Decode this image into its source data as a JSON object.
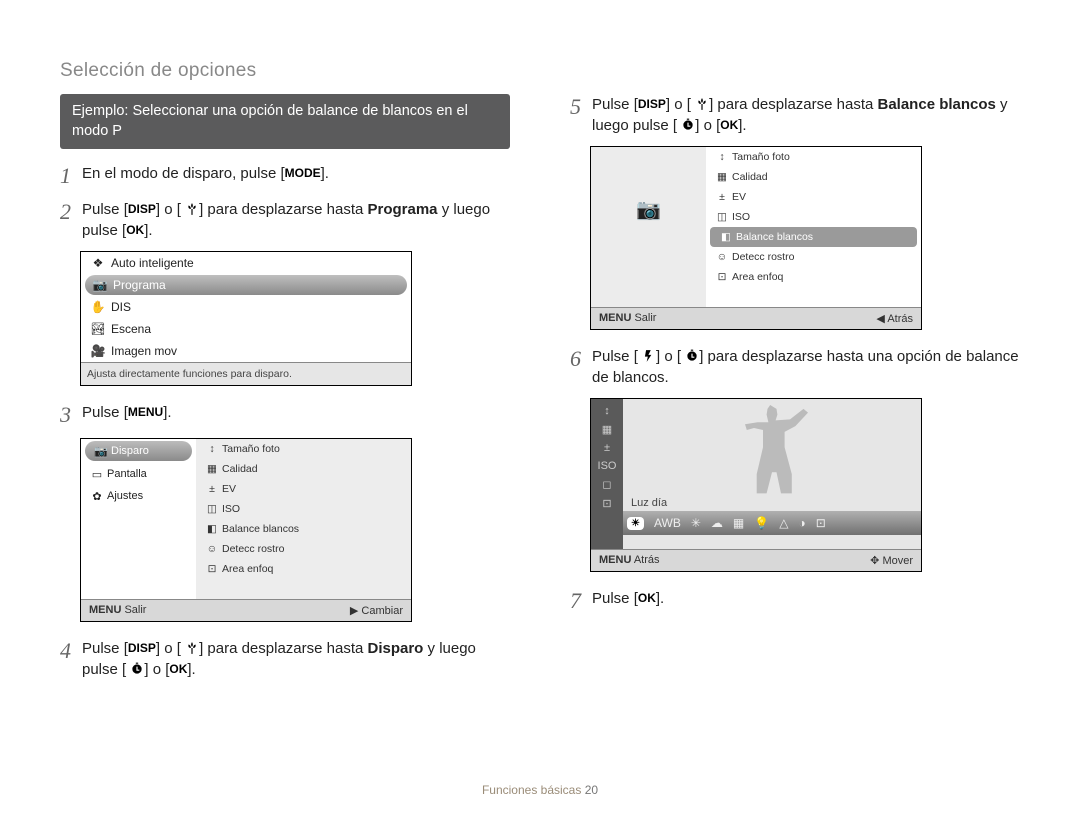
{
  "header": "Selección de opciones",
  "example_pill": "Ejemplo: Seleccionar una opción de balance de blancos en el modo P",
  "buttons": {
    "mode": "MODE",
    "disp": "DISP",
    "menu": "MENU",
    "ok": "OK"
  },
  "steps": {
    "s1_a": "En el modo de disparo, pulse [",
    "s1_b": "].",
    "s2_a": "Pulse [",
    "s2_b": "] o [",
    "s2_c": "] para desplazarse hasta ",
    "s2_prog": "Programa",
    "s2_d": " y luego pulse [",
    "s2_e": "].",
    "s3_a": "Pulse [",
    "s3_b": "].",
    "s4_a": "Pulse [",
    "s4_b": "] o [",
    "s4_c": "] para desplazarse hasta ",
    "s4_disp": "Disparo",
    "s4_d": " y luego pulse [",
    "s4_e": "] o [",
    "s4_f": "].",
    "s5_a": "Pulse [",
    "s5_b": "] o [",
    "s5_c": "] para desplazarse hasta ",
    "s5_bal": "Balance blancos",
    "s5_d": " y luego pulse [",
    "s5_e": "] o [",
    "s5_f": "].",
    "s6_a": "Pulse [",
    "s6_b": "] o [",
    "s6_c": "] para desplazarse hasta una opción de balance de blancos.",
    "s7_a": "Pulse [",
    "s7_b": "]."
  },
  "lcd1": {
    "items": [
      "Auto inteligente",
      "Programa",
      "DIS",
      "Escena",
      "Imagen mov"
    ],
    "selected_index": 1,
    "caption": "Ajusta directamente funciones para disparo."
  },
  "lcd2": {
    "tabs": [
      "Disparo",
      "Pantalla",
      "Ajustes"
    ],
    "tabs_selected_index": 0,
    "right_items": [
      "Tamaño foto",
      "Calidad",
      "EV",
      "ISO",
      "Balance blancos",
      "Detecc rostro",
      "Area enfoq"
    ],
    "footer_left_icon": "MENU",
    "footer_left": "Salir",
    "footer_right_icon": "▶",
    "footer_right": "Cambiar"
  },
  "lcd3": {
    "right_items": [
      "Tamaño foto",
      "Calidad",
      "EV",
      "ISO",
      "Balance blancos",
      "Detecc rostro",
      "Area enfoq"
    ],
    "right_selected_index": 4,
    "footer_left_icon": "MENU",
    "footer_left": "Salir",
    "footer_right_icon": "◀",
    "footer_right": "Atrás"
  },
  "wb": {
    "current_label": "Luz día",
    "strip": [
      "☀",
      "AWB",
      "✳",
      "☁",
      "▦",
      "💡",
      "△",
      "◑",
      "⊡"
    ],
    "left_icons": [
      "↕",
      "▦",
      "±",
      "ISO",
      "◻",
      "⊡"
    ],
    "footer_left_icon": "MENU",
    "footer_left": "Atrás",
    "footer_right_icon": "✥",
    "footer_right": "Mover"
  },
  "footer": {
    "section": "Funciones básicas",
    "page": "20"
  }
}
